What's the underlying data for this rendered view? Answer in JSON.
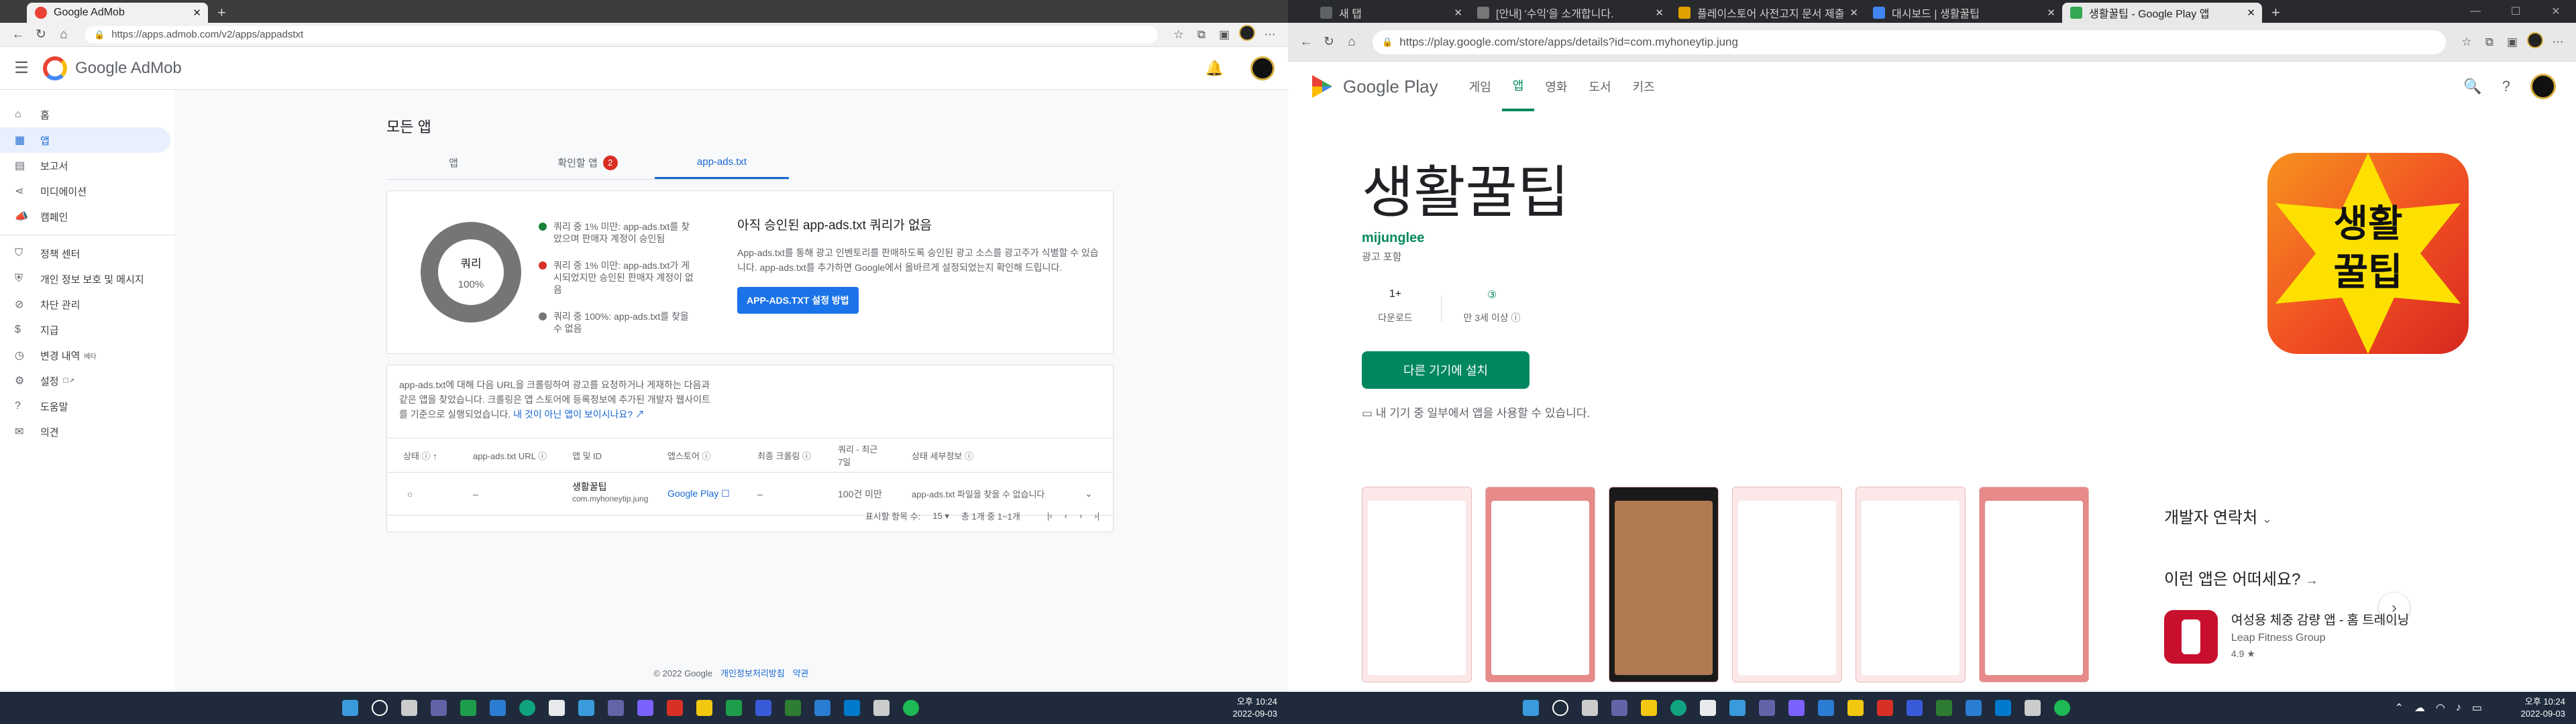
{
  "left": {
    "tabs": [
      {
        "label": "Google AdMob",
        "active": true
      }
    ],
    "url": "https://apps.admob.com/v2/apps/appadstxt",
    "app_name": "Google AdMob",
    "sidebar": [
      {
        "label": "홈",
        "icon": "home-icon"
      },
      {
        "label": "앱",
        "icon": "apps-icon",
        "selected": true
      },
      {
        "label": "보고서",
        "icon": "report-icon"
      },
      {
        "label": "미디에이션",
        "icon": "mediation-icon"
      },
      {
        "label": "캠페인",
        "icon": "campaign-icon"
      },
      {
        "label": "정책 센터",
        "icon": "shield-icon"
      },
      {
        "label": "개인 정보 보호 및 메시지",
        "icon": "privacy-icon"
      },
      {
        "label": "차단 관리",
        "icon": "block-icon"
      },
      {
        "label": "지급",
        "icon": "payment-icon"
      },
      {
        "label": "변경 내역",
        "icon": "history-icon",
        "sup": "베타"
      },
      {
        "label": "설정",
        "icon": "gear-icon",
        "sup": "☐↗"
      },
      {
        "label": "도움말",
        "icon": "help-icon"
      },
      {
        "label": "의견",
        "icon": "feedback-icon"
      }
    ],
    "page_title": "모든 앱",
    "tabs_main": [
      {
        "label": "앱"
      },
      {
        "label": "확인할 앱",
        "badge": "2"
      },
      {
        "label": "app-ads.txt",
        "active": true
      }
    ],
    "card1": {
      "donut_title": "쿼리",
      "donut_pct": "100%",
      "legend": [
        {
          "color": "#188038",
          "text": "쿼리 중 1% 미만: app-ads.txt를 찾았으며 판매자 계정이 승인됨"
        },
        {
          "color": "#d93025",
          "text": "쿼리 중 1% 미만: app-ads.txt가 게시되었지만 승인된 판매자 계정이 없음"
        },
        {
          "color": "#757575",
          "text": "쿼리 중 100%: app-ads.txt를 찾을 수 없음"
        }
      ],
      "heading": "아직 승인된 app-ads.txt 쿼리가 없음",
      "body": "App-ads.txt를 통해 광고 인벤토리를 판매하도록 승인된 광고 소스를 광고주가 식별할 수 있습니다. app-ads.txt를 추가하면 Google에서 올바르게 설정되었는지 확인해 드립니다.",
      "button": "APP-ADS.TXT 설정 방법"
    },
    "card2": {
      "text": "app-ads.txt에 대해 다음 URL을 크롤링하여 광고를 요청하거나 게재하는 다음과 같은 앱을 찾았습니다. 크롤링은 앱 스토어에 등록정보에 추가된 개발자 웹사이트를 기준으로 실행되었습니다.",
      "link": "내 것이 아닌 앱이 보이시나요?",
      "columns": [
        "상태 ⓘ ↑",
        "app-ads.txt URL ⓘ",
        "앱 및 ID",
        "앱스토어 ⓘ",
        "최종 크롤링 ⓘ",
        "쿼리 - 최근 7일",
        "상태 세부정보 ⓘ"
      ],
      "row": {
        "status": "○",
        "url": "–",
        "app": "생활꿀팁",
        "app_id": "com.myhoneytip.jung",
        "store": "Google Play ☐",
        "crawl": "–",
        "queries": "100건 미만",
        "detail": "app-ads.txt 파일을 찾을 수 없습니다"
      },
      "rows_per_page_label": "표시할 항목 수:",
      "rows_per_page": "15 ▾",
      "range": "총 1개 중 1~1개"
    },
    "footer": {
      "copy": "© 2022 Google",
      "privacy": "개인정보처리방침",
      "terms": "약관"
    }
  },
  "right": {
    "tabs": [
      {
        "label": "새 탭"
      },
      {
        "label": "[안내] '수익'을 소개합니다."
      },
      {
        "label": "플레이스토어 사전고지 문서 제출"
      },
      {
        "label": "대시보드 | 생활꿀팁"
      },
      {
        "label": "생활꿀팁 - Google Play 앱",
        "active": true
      }
    ],
    "url": "https://play.google.com/store/apps/details?id=com.myhoneytip.jung",
    "brand": "Google Play",
    "nav": [
      "게임",
      "앱",
      "영화",
      "도서",
      "키즈"
    ],
    "nav_active": "앱",
    "app_title": "생활꿀팁",
    "developer": "mijunglee",
    "contains_ads": "광고 포함",
    "stats": [
      {
        "value": "1+",
        "label": "다운로드"
      },
      {
        "value": "③",
        "label": "만 3세 이상 ⓘ"
      }
    ],
    "install_button": "다른 기기에 설치",
    "devices_note": "내 기기 중 일부에서 앱을 사용할 수 있습니다.",
    "icon_text": [
      "생활",
      "꿀팁"
    ],
    "developer_contact": "개발자 연락처",
    "about_similar": "이런 앱은 어떠세요?",
    "recommended": {
      "name": "여성용 체중 감량 앱 - 홈 트레이닝",
      "dev": "Leap Fitness Group",
      "rating": "4.9 ★"
    }
  },
  "taskbar_left": {
    "time": "오후 10:24",
    "date": "2022-09-03"
  },
  "taskbar_right": {
    "time": "오후 10:24",
    "date": "2022-09-03"
  }
}
